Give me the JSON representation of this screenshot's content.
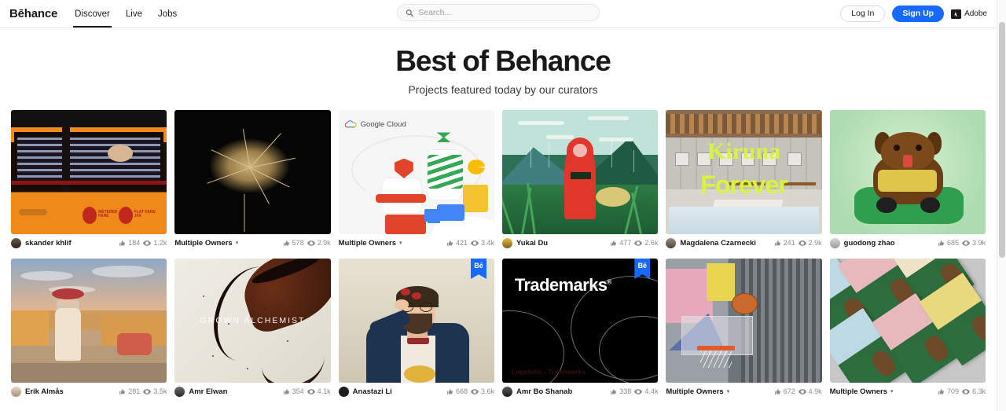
{
  "header": {
    "brand": "Bēhance",
    "nav": [
      {
        "label": "Discover",
        "active": true
      },
      {
        "label": "Live",
        "active": false
      },
      {
        "label": "Jobs",
        "active": false
      }
    ],
    "search": {
      "placeholder": "Search...",
      "value": "",
      "icon": "search-icon"
    },
    "login_label": "Log In",
    "signup_label": "Sign Up",
    "adobe_label": "Adobe",
    "accent_color": "#1769ff"
  },
  "page": {
    "title": "Best of Behance",
    "subtitle": "Projects featured today by our curators"
  },
  "icons": {
    "like": "thumbs-up-icon",
    "views": "eye-icon",
    "caret": "▾"
  },
  "cards": [
    {
      "owner": "skander khlif",
      "multiple": false,
      "likes": "184",
      "views": "1.2k",
      "art": "taxi",
      "featured": false
    },
    {
      "owner": "Multiple Owners",
      "multiple": true,
      "likes": "578",
      "views": "2.9k",
      "art": "flower",
      "featured": false
    },
    {
      "owner": "Multiple Owners",
      "multiple": true,
      "likes": "421",
      "views": "3.4k",
      "art": "gcloud",
      "featured": false,
      "brand_text": "Google Cloud"
    },
    {
      "owner": "Yukai Du",
      "multiple": false,
      "likes": "477",
      "views": "2.6k",
      "art": "rain",
      "featured": false
    },
    {
      "owner": "Magdalena Czarnecki",
      "multiple": false,
      "likes": "241",
      "views": "2.9k",
      "art": "kiruna",
      "featured": false,
      "overlay_line1": "Kiruna",
      "overlay_line2": "Forever"
    },
    {
      "owner": "guodong zhao",
      "multiple": false,
      "likes": "685",
      "views": "3.9k",
      "art": "dog",
      "featured": false
    },
    {
      "owner": "Erik Almås",
      "multiple": false,
      "likes": "281",
      "views": "3.5k",
      "art": "fashion",
      "featured": false
    },
    {
      "owner": "Amr Elwan",
      "multiple": false,
      "likes": "354",
      "views": "4.1k",
      "art": "alch",
      "featured": false,
      "overlay_text": "GROWN ALCHEMIST"
    },
    {
      "owner": "Anastazi Li",
      "multiple": false,
      "likes": "668",
      "views": "3.6k",
      "art": "portrait",
      "featured": true,
      "badge": "Bē"
    },
    {
      "owner": "Amr Bo Shanab",
      "multiple": false,
      "likes": "338",
      "views": "4.4k",
      "art": "tm",
      "featured": true,
      "badge": "Bē",
      "overlay_text": "Trademarks",
      "caption": "Logofolio - Trademarks"
    },
    {
      "owner": "Multiple Owners",
      "multiple": true,
      "likes": "672",
      "views": "4.9k",
      "art": "ball",
      "featured": false
    },
    {
      "owner": "Multiple Owners",
      "multiple": true,
      "likes": "709",
      "views": "6.3k",
      "art": "books",
      "featured": false
    }
  ]
}
